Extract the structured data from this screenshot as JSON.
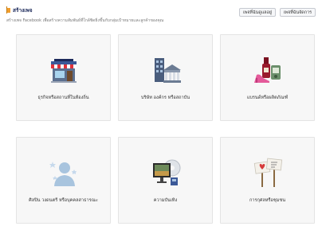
{
  "header": {
    "title": "สร้างเพจ",
    "subtitle": "สร้างเพจ Facebook เพื่อสร้างความสัมพันธ์ที่ใกล้ชิดยิ่งขึ้นกับกลุ่มเป้าหมายและลูกค้าของคุณ",
    "button_1": "เพจที่ฉันดูแลอยู่",
    "button_2": "เพจที่ฉันจัดการ"
  },
  "tiles": [
    {
      "label": "ธุรกิจหรือสถานที่ในท้องถิ่น",
      "icon": "storefront-icon"
    },
    {
      "label": "บริษัท องค์กร หรือสถาบัน",
      "icon": "office-buildings-icon"
    },
    {
      "label": "แบรนด์หรือผลิตภัณฑ์",
      "icon": "products-icon"
    },
    {
      "label": "ศิลปิน วงดนตรี หรือบุคคลสาธารณะ",
      "icon": "star-person-icon"
    },
    {
      "label": "ความบันเทิง",
      "icon": "entertainment-icon"
    },
    {
      "label": "การกุศลหรือชุมชน",
      "icon": "protest-signs-icon"
    }
  ],
  "colors": {
    "accent": "#f29e2c",
    "title": "#1d2a5b",
    "tile_bg": "#f7f7f7"
  }
}
